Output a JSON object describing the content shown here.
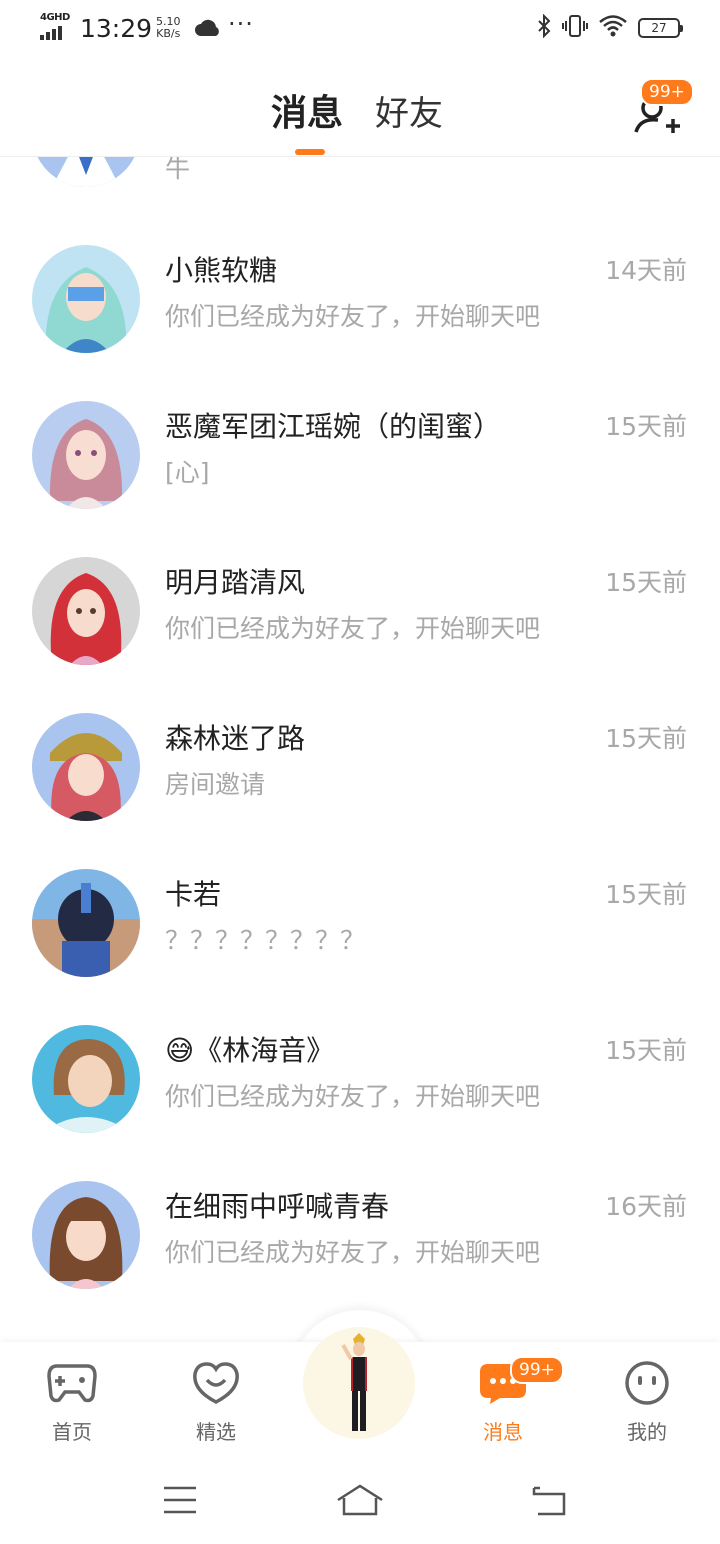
{
  "status_bar": {
    "network": "4GHD",
    "time": "13:29",
    "speed_value": "5.10",
    "speed_unit": "KB/s",
    "more": "···",
    "battery": "27"
  },
  "header": {
    "tabs": [
      {
        "label": "消息",
        "active": true
      },
      {
        "label": "好友",
        "active": false
      }
    ],
    "add_friend_badge": "99+"
  },
  "conversations": [
    {
      "name": "",
      "preview": "牛",
      "time": ""
    },
    {
      "name": "小熊软糖",
      "preview": "你们已经成为好友了，开始聊天吧",
      "time": "14天前"
    },
    {
      "name": "恶魔军团江瑶婉（的闺蜜）",
      "preview": "[心]",
      "time": "15天前"
    },
    {
      "name": "明月踏清风",
      "preview": "你们已经成为好友了，开始聊天吧",
      "time": "15天前"
    },
    {
      "name": "森林迷了路",
      "preview": "房间邀请",
      "time": "15天前"
    },
    {
      "name": "卡若",
      "preview": "？？？？？？？？",
      "time": "15天前"
    },
    {
      "name": "😅《林海音》",
      "preview": "你们已经成为好友了，开始聊天吧",
      "time": "15天前"
    },
    {
      "name": "在细雨中呼喊青春",
      "preview": "你们已经成为好友了，开始聊天吧",
      "time": "16天前"
    }
  ],
  "bottom_nav": {
    "items": [
      {
        "label": "首页",
        "icon": "gamepad-icon"
      },
      {
        "label": "精选",
        "icon": "heart-chat-icon"
      },
      {
        "label": "消息",
        "icon": "message-icon",
        "active": true
      },
      {
        "label": "我的",
        "icon": "smiley-icon"
      }
    ],
    "message_badge": "99+"
  },
  "colors": {
    "accent": "#ff7a1a",
    "muted_text": "#a8a8a8"
  }
}
